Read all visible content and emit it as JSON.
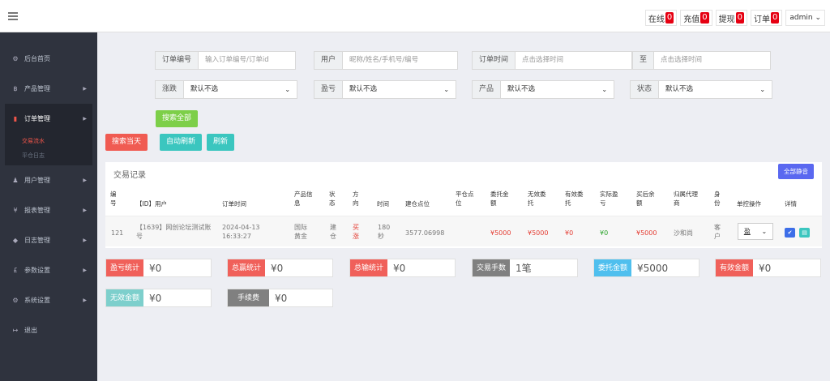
{
  "topbar": {
    "buttons": [
      {
        "label": "在线",
        "count": "0"
      },
      {
        "label": "充值",
        "count": "0"
      },
      {
        "label": "提现",
        "count": "0"
      },
      {
        "label": "订单",
        "count": "0"
      }
    ],
    "user": "admin",
    "caret": "⌄"
  },
  "sidebar": {
    "items": [
      {
        "icon": "⚙",
        "label": "后台首页",
        "arrow": ""
      },
      {
        "icon": "฿",
        "label": "产品管理",
        "arrow": "▶"
      },
      {
        "icon": "▮",
        "label": "订单管理",
        "arrow": "▶"
      },
      {
        "icon": "♟",
        "label": "用户管理",
        "arrow": "▶"
      },
      {
        "icon": "¥",
        "label": "报表管理",
        "arrow": "▶"
      },
      {
        "icon": "◆",
        "label": "日志管理",
        "arrow": "▶"
      },
      {
        "icon": "£",
        "label": "参数设置",
        "arrow": "▶"
      },
      {
        "icon": "⚙",
        "label": "系统设置",
        "arrow": "▶"
      },
      {
        "icon": "↦",
        "label": "退出",
        "arrow": ""
      }
    ],
    "sub": [
      "交易流水",
      "平仓日志"
    ]
  },
  "filters": {
    "order_no": {
      "label": "订单编号",
      "placeholder": "输入订单编号/订单id"
    },
    "user": {
      "label": "用户",
      "placeholder": "昵称/姓名/手机号/编号"
    },
    "order_time": {
      "label": "订单时间",
      "placeholder": "点击选择时间"
    },
    "to": {
      "label": "至",
      "placeholder": "点击选择时间"
    },
    "rise_fall": {
      "label": "涨跌",
      "value": "默认不选"
    },
    "profit_loss": {
      "label": "盈亏",
      "value": "默认不选"
    },
    "product": {
      "label": "产品",
      "value": "默认不选"
    },
    "status": {
      "label": "状态",
      "value": "默认不选"
    },
    "caret": "⌄"
  },
  "buttons": {
    "search_all": "搜索全部",
    "search_today": "搜索当天",
    "auto_refresh": "自动刷新",
    "refresh": "刷新"
  },
  "panel": {
    "title": "交易记录",
    "mute_all": "全部静音",
    "headers": [
      "编号",
      "【ID】用户",
      "订单时间",
      "产品信息",
      "状态",
      "方向",
      "时间",
      "建仓点位",
      "平仓点位",
      "委托金额",
      "无效委托",
      "有效委托",
      "实际盈亏",
      "买后余额",
      "归属代理商",
      "身份",
      "单控操作",
      "详情"
    ],
    "row": {
      "id": "121",
      "user": "【1639】网创论坛测试账号",
      "time": "2024-04-13 16:33:27",
      "product": "国际黄金",
      "status": "建仓",
      "direction": "买涨",
      "duration": "180秒",
      "open": "3577.06998",
      "close": "",
      "amount": "¥5000",
      "invalid": "¥5000",
      "valid": "¥0",
      "pl": "¥0",
      "balance": "¥5000",
      "agent": "沙和尚",
      "role": "客户",
      "control": "盈",
      "check": "✔",
      "detail": "▤"
    }
  },
  "stats": [
    {
      "label": "盈亏统计",
      "value": "¥0"
    },
    {
      "label": "总赢统计",
      "value": "¥0"
    },
    {
      "label": "总输统计",
      "value": "¥0"
    },
    {
      "label": "交易手数",
      "value": "1笔"
    },
    {
      "label": "委托金额",
      "value": "¥5000"
    },
    {
      "label": "有效金额",
      "value": "¥0"
    },
    {
      "label": "无效金额",
      "value": "¥0"
    },
    {
      "label": "手续费",
      "value": "¥0"
    }
  ]
}
